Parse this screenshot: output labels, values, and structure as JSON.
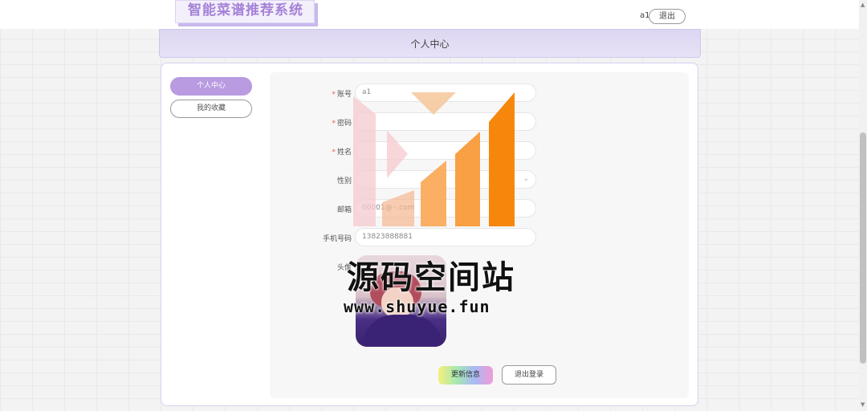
{
  "header": {
    "logo_text": "智能菜谱推荐系统",
    "username": "a1",
    "logout_label": "退出"
  },
  "banner": {
    "title": "个人中心"
  },
  "sidebar": {
    "items": [
      {
        "label": "个人中心",
        "active": true
      },
      {
        "label": "我的收藏",
        "active": false
      }
    ]
  },
  "form": {
    "account": {
      "label": "账号",
      "value": "a1",
      "required": true
    },
    "password": {
      "label": "密码",
      "value": "",
      "required": true
    },
    "name": {
      "label": "姓名",
      "value": "",
      "required": true
    },
    "gender": {
      "label": "性别",
      "value": ""
    },
    "email": {
      "label": "邮箱",
      "value": "00001@··.com"
    },
    "phone": {
      "label": "手机号码",
      "value": "13823888881"
    },
    "avatar": {
      "label": "头像"
    },
    "required_mark": "*"
  },
  "actions": {
    "update_label": "更新信息",
    "logout_label": "退出登录"
  },
  "watermark": {
    "text": "源码空间站",
    "url": "www.shuyue.fun"
  },
  "colors": {
    "accent": "#b89be0",
    "logo": "#a582d8",
    "required": "#e25b5b"
  }
}
